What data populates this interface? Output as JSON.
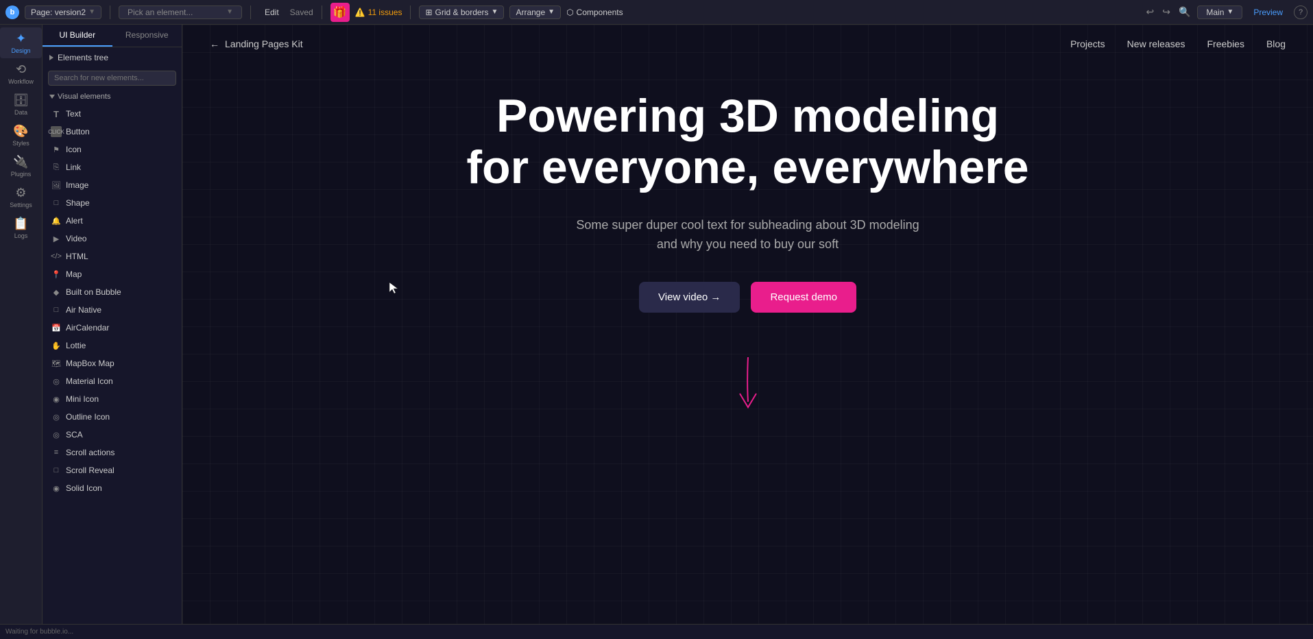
{
  "topbar": {
    "logo_text": "b",
    "page_name": "Page: version2",
    "pick_element_placeholder": "Pick an element...",
    "edit_label": "Edit",
    "saved_label": "Saved",
    "issues_count": "11 issues",
    "grid_borders_label": "Grid & borders",
    "arrange_label": "Arrange",
    "components_label": "Components",
    "main_label": "Main",
    "preview_label": "Preview"
  },
  "left_nav": {
    "items": [
      {
        "id": "design",
        "label": "Design",
        "active": true
      },
      {
        "id": "workflow",
        "label": "Workflow",
        "active": false
      },
      {
        "id": "data",
        "label": "Data",
        "active": false
      },
      {
        "id": "styles",
        "label": "Styles",
        "active": false
      },
      {
        "id": "plugins",
        "label": "Plugins",
        "active": false
      },
      {
        "id": "settings",
        "label": "Settings",
        "active": false
      },
      {
        "id": "logs",
        "label": "Logs",
        "active": false
      }
    ]
  },
  "elements_panel": {
    "tab_ui_builder": "UI Builder",
    "tab_responsive": "Responsive",
    "elements_tree_label": "Elements tree",
    "search_placeholder": "Search for new elements...",
    "visual_elements_label": "Visual elements",
    "elements": [
      {
        "name": "Text",
        "icon": "T"
      },
      {
        "name": "Button",
        "icon": "CLICK"
      },
      {
        "name": "Icon",
        "icon": "⚑"
      },
      {
        "name": "Link",
        "icon": "⎋"
      },
      {
        "name": "Image",
        "icon": "⊡"
      },
      {
        "name": "Shape",
        "icon": "□"
      },
      {
        "name": "Alert",
        "icon": "🔔"
      },
      {
        "name": "Video",
        "icon": "▶"
      },
      {
        "name": "HTML",
        "icon": "</>"
      },
      {
        "name": "Map",
        "icon": "📍"
      },
      {
        "name": "Built on Bubble",
        "icon": "◆"
      },
      {
        "name": "Air Native",
        "icon": "□"
      },
      {
        "name": "AirCalendar",
        "icon": "□"
      },
      {
        "name": "Lottie",
        "icon": "✋"
      },
      {
        "name": "MapBox Map",
        "icon": "🚗"
      },
      {
        "name": "Material Icon",
        "icon": "◎"
      },
      {
        "name": "Mini Icon",
        "icon": "◉"
      },
      {
        "name": "Outline Icon",
        "icon": "◉"
      },
      {
        "name": "SCA",
        "icon": "◎"
      },
      {
        "name": "Scroll actions",
        "icon": "☰"
      },
      {
        "name": "Scroll Reveal",
        "icon": "□"
      },
      {
        "name": "Solid Icon",
        "icon": "◉"
      }
    ]
  },
  "canvas": {
    "nav": {
      "back_arrow": "←",
      "title": "Landing Pages Kit",
      "links": [
        "Projects",
        "New releases",
        "Freebies",
        "Blog"
      ]
    },
    "hero": {
      "title_line1": "Powering 3D modeling",
      "title_line2": "for everyone, everywhere",
      "subtitle_line1": "Some super duper cool text for subheading about 3D modeling",
      "subtitle_line2": "and why you need to buy our soft",
      "btn_video": "View video →",
      "btn_demo": "Request demo"
    }
  },
  "status_bar": {
    "text": "Waiting for bubble.io..."
  },
  "colors": {
    "accent_blue": "#4a9eff",
    "accent_pink": "#e91e8c",
    "bg_dark": "#0f0f1e",
    "panel_bg": "#16162a",
    "topbar_bg": "#1e1e2e"
  }
}
